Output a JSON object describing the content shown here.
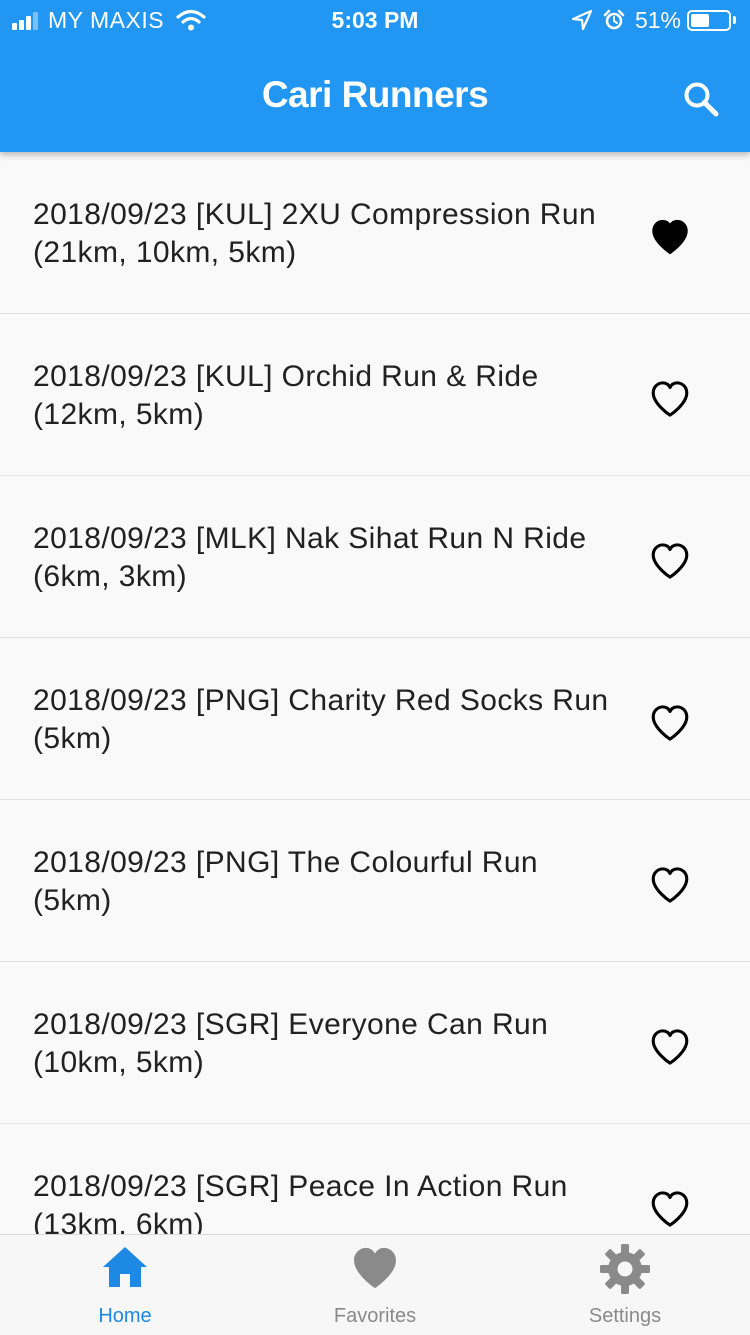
{
  "status_bar": {
    "carrier": "MY MAXIS",
    "time": "5:03 PM",
    "battery_percent": "51%",
    "battery_level": 0.51,
    "signal_bars_filled": 3,
    "signal_bars_total": 4
  },
  "app_bar": {
    "title": "Cari Runners",
    "background_color": "#2196f3",
    "search_icon": "search-icon"
  },
  "events": [
    {
      "title": "2018/09/23 [KUL] 2XU Compression Run (21km, 10km, 5km)",
      "favorite": true
    },
    {
      "title": "2018/09/23 [KUL] Orchid Run & Ride (12km, 5km)",
      "favorite": false
    },
    {
      "title": "2018/09/23 [MLK] Nak Sihat Run N Ride (6km, 3km)",
      "favorite": false
    },
    {
      "title": "2018/09/23 [PNG] Charity Red Socks Run (5km)",
      "favorite": false
    },
    {
      "title": "2018/09/23 [PNG] The Colourful Run (5km)",
      "favorite": false
    },
    {
      "title": "2018/09/23 [SGR] Everyone Can Run (10km, 5km)",
      "favorite": false
    },
    {
      "title": "2018/09/23 [SGR] Peace In Action Run (13km, 6km)",
      "favorite": false
    }
  ],
  "bottom_nav": {
    "active_index": 0,
    "active_color": "#1e88e5",
    "inactive_color": "#8a8a8a",
    "items": [
      {
        "label": "Home",
        "icon": "home-icon"
      },
      {
        "label": "Favorites",
        "icon": "heart-icon"
      },
      {
        "label": "Settings",
        "icon": "gear-icon"
      }
    ]
  }
}
